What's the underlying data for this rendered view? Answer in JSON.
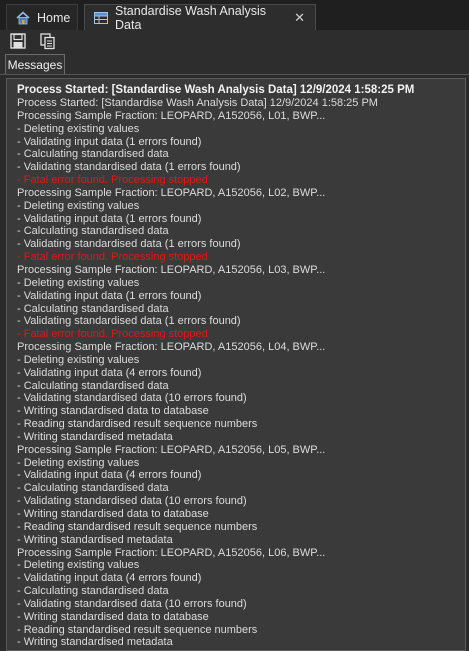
{
  "tabs": {
    "home_label": "Home",
    "active_label": "Standardise Wash Analysis Data",
    "close_glyph": "✕"
  },
  "panel": {
    "tab_label": "Messages"
  },
  "messages": {
    "header": "Process Started: [Standardise Wash Analysis Data] 12/9/2024 1:58:25 PM",
    "lines": [
      {
        "text": "Process Started: [Standardise Wash Analysis Data]  12/9/2024 1:58:25 PM",
        "type": "normal"
      },
      {
        "text": "Processing Sample Fraction: LEOPARD, A152056, L01, BWP...",
        "type": "normal"
      },
      {
        "text": " - Deleting existing values",
        "type": "normal"
      },
      {
        "text": " - Validating input data (1 errors found)",
        "type": "normal"
      },
      {
        "text": " - Calculating standardised data",
        "type": "normal"
      },
      {
        "text": " - Validating standardised data (1 errors found)",
        "type": "normal"
      },
      {
        "text": " - Fatal error found. Processing stopped",
        "type": "error"
      },
      {
        "text": "Processing Sample Fraction: LEOPARD, A152056, L02, BWP...",
        "type": "normal"
      },
      {
        "text": " - Deleting existing values",
        "type": "normal"
      },
      {
        "text": " - Validating input data (1 errors found)",
        "type": "normal"
      },
      {
        "text": " - Calculating standardised data",
        "type": "normal"
      },
      {
        "text": " - Validating standardised data (1 errors found)",
        "type": "normal"
      },
      {
        "text": " - Fatal error found. Processing stopped",
        "type": "error"
      },
      {
        "text": "Processing Sample Fraction: LEOPARD, A152056, L03, BWP...",
        "type": "normal"
      },
      {
        "text": " - Deleting existing values",
        "type": "normal"
      },
      {
        "text": " - Validating input data (1 errors found)",
        "type": "normal"
      },
      {
        "text": " - Calculating standardised data",
        "type": "normal"
      },
      {
        "text": " - Validating standardised data (1 errors found)",
        "type": "normal"
      },
      {
        "text": " - Fatal error found. Processing stopped",
        "type": "error"
      },
      {
        "text": "Processing Sample Fraction: LEOPARD, A152056, L04, BWP...",
        "type": "normal"
      },
      {
        "text": " - Deleting existing values",
        "type": "normal"
      },
      {
        "text": " - Validating input data (4 errors found)",
        "type": "normal"
      },
      {
        "text": " - Calculating standardised data",
        "type": "normal"
      },
      {
        "text": " - Validating standardised data (10 errors found)",
        "type": "normal"
      },
      {
        "text": " - Writing standardised data to database",
        "type": "normal"
      },
      {
        "text": " - Reading standardised result sequence numbers",
        "type": "normal"
      },
      {
        "text": " - Writing standardised metadata",
        "type": "normal"
      },
      {
        "text": "Processing Sample Fraction: LEOPARD, A152056, L05, BWP...",
        "type": "normal"
      },
      {
        "text": " - Deleting existing values",
        "type": "normal"
      },
      {
        "text": " - Validating input data (4 errors found)",
        "type": "normal"
      },
      {
        "text": " - Calculating standardised data",
        "type": "normal"
      },
      {
        "text": " - Validating standardised data (10 errors found)",
        "type": "normal"
      },
      {
        "text": " - Writing standardised data to database",
        "type": "normal"
      },
      {
        "text": " - Reading standardised result sequence numbers",
        "type": "normal"
      },
      {
        "text": " - Writing standardised metadata",
        "type": "normal"
      },
      {
        "text": "Processing Sample Fraction: LEOPARD, A152056, L06, BWP...",
        "type": "normal"
      },
      {
        "text": " - Deleting existing values",
        "type": "normal"
      },
      {
        "text": " - Validating input data (4 errors found)",
        "type": "normal"
      },
      {
        "text": " - Calculating standardised data",
        "type": "normal"
      },
      {
        "text": " - Validating standardised data (10 errors found)",
        "type": "normal"
      },
      {
        "text": " - Writing standardised data to database",
        "type": "normal"
      },
      {
        "text": " - Reading standardised result sequence numbers",
        "type": "normal"
      },
      {
        "text": " - Writing standardised metadata",
        "type": "normal"
      }
    ]
  },
  "icons": {
    "home": "home-icon",
    "grid": "grid-icon",
    "save": "save-icon",
    "copy": "copy-icon"
  },
  "colors": {
    "error_text": "#e01818",
    "background": "#2b2b2b",
    "panel": "#3a3a3a"
  }
}
